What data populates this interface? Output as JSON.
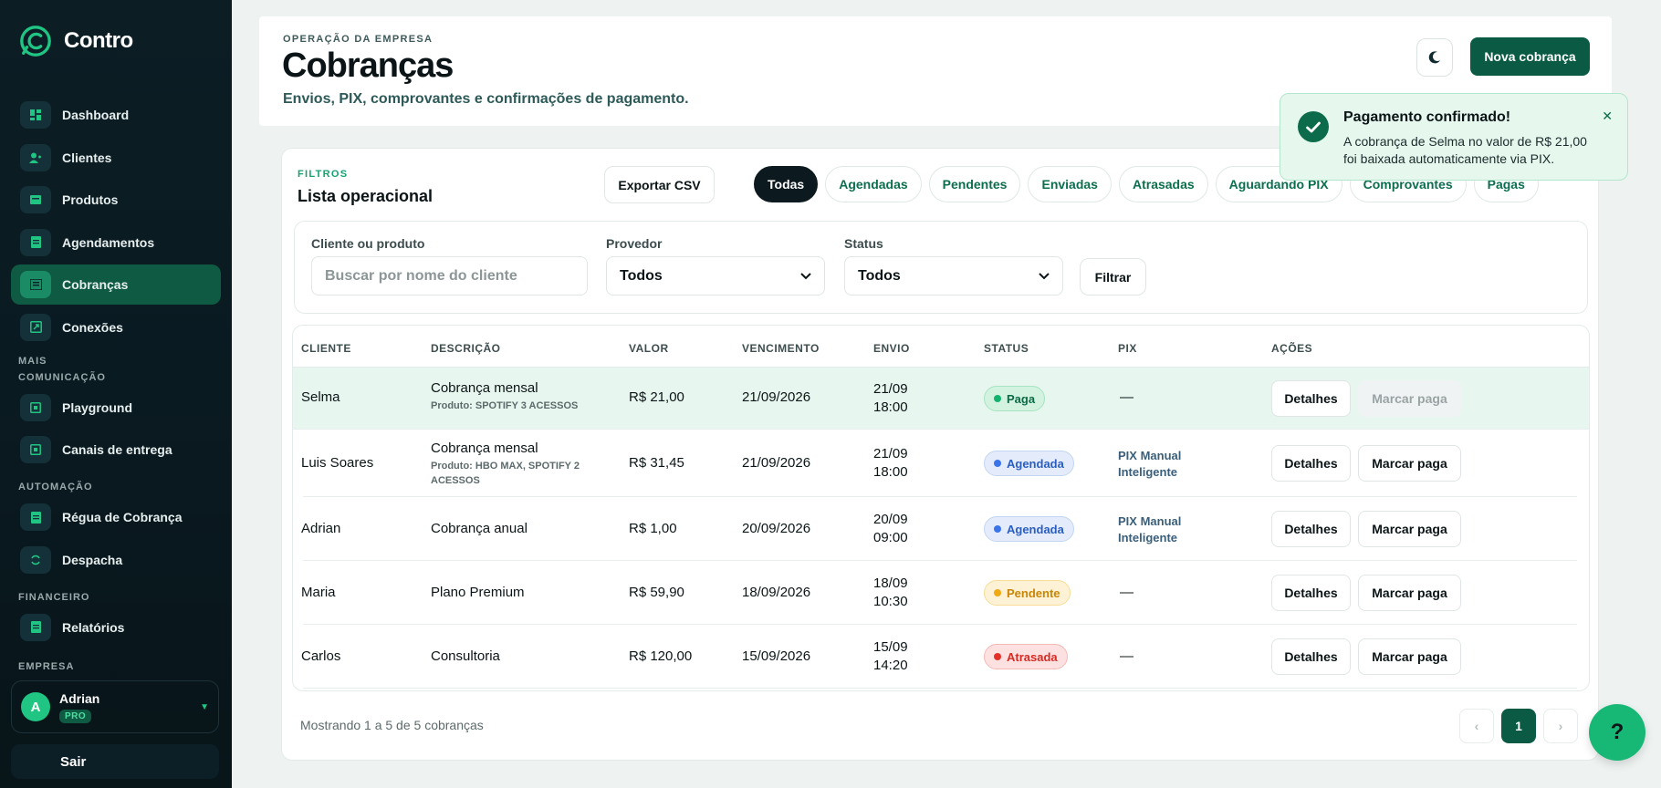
{
  "app": {
    "name": "Contro"
  },
  "sidebar": {
    "items": [
      {
        "label": "Dashboard",
        "icon": "dashboard-icon"
      },
      {
        "label": "Clientes",
        "icon": "users-icon"
      },
      {
        "label": "Produtos",
        "icon": "box-icon"
      },
      {
        "label": "Agendamentos",
        "icon": "calendar-icon"
      },
      {
        "label": "Cobranças",
        "icon": "receipt-icon",
        "active": true
      },
      {
        "label": "Conexões",
        "icon": "link-icon"
      }
    ],
    "sections": [
      {
        "title": "MAIS COMUNICAÇÃO",
        "items": [
          {
            "label": "Playground"
          },
          {
            "label": "Canais de entrega"
          }
        ]
      },
      {
        "title": "AUTOMAÇÃO",
        "items": [
          {
            "label": "Régua de Cobrança"
          },
          {
            "label": "Despacha"
          }
        ]
      },
      {
        "title": "FINANCEIRO",
        "items": [
          {
            "label": "Relatórios"
          }
        ]
      },
      {
        "title": "EMPRESA"
      }
    ],
    "user": {
      "initial": "A",
      "name": "Adrian",
      "plan": "PRO"
    },
    "logout_label": "Sair"
  },
  "header": {
    "eyebrow": "OPERAÇÃO DA EMPRESA",
    "title": "Cobranças",
    "subtitle": "Envios, PIX, comprovantes e confirmações de pagamento.",
    "new_button": "Nova cobrança"
  },
  "filters": {
    "eyebrow": "FILTROS",
    "title": "Lista operacional",
    "export_label": "Exportar CSV",
    "chips": [
      "Todas",
      "Agendadas",
      "Pendentes",
      "Enviadas",
      "Atrasadas",
      "Aguardando PIX",
      "Comprovantes",
      "Pagas"
    ],
    "active_chip": "Todas",
    "client_label": "Cliente ou produto",
    "client_placeholder": "Buscar por nome do cliente",
    "provider_label": "Provedor",
    "provider_value": "Todos",
    "status_label": "Status",
    "status_value": "Todos",
    "filter_button": "Filtrar"
  },
  "table": {
    "columns": [
      "CLIENTE",
      "DESCRIÇÃO",
      "VALOR",
      "VENCIMENTO",
      "ENVIO",
      "STATUS",
      "PIX",
      "AÇÕES"
    ],
    "rows": [
      {
        "client": "Selma",
        "desc": "Cobrança mensal",
        "desc_sub": "Produto: SPOTIFY 3 ACESSOS",
        "value": "R$ 21,00",
        "due": "21/09/2026",
        "send_date": "21/09",
        "send_time": "18:00",
        "status": "Paga",
        "status_kind": "paga",
        "pix_line1": "—",
        "pix_line2": "",
        "details": "Detalhes",
        "mark": "Marcar paga",
        "mark_disabled": true
      },
      {
        "client": "Luis Soares",
        "desc": "Cobrança mensal",
        "desc_sub": "Produto: HBO MAX, SPOTIFY 2 ACESSOS",
        "value": "R$ 31,45",
        "due": "21/09/2026",
        "send_date": "21/09",
        "send_time": "18:00",
        "status": "Agendada",
        "status_kind": "agendada",
        "pix_line1": "PIX Manual",
        "pix_line2": "Inteligente",
        "details": "Detalhes",
        "mark": "Marcar paga"
      },
      {
        "client": "Adrian",
        "desc": "Cobrança anual",
        "desc_sub": "",
        "value": "R$ 1,00",
        "due": "20/09/2026",
        "send_date": "20/09",
        "send_time": "09:00",
        "status": "Agendada",
        "status_kind": "agendada",
        "pix_line1": "PIX Manual",
        "pix_line2": "Inteligente",
        "details": "Detalhes",
        "mark": "Marcar paga"
      },
      {
        "client": "Maria",
        "desc": "Plano Premium",
        "desc_sub": "",
        "value": "R$ 59,90",
        "due": "18/09/2026",
        "send_date": "18/09",
        "send_time": "10:30",
        "status": "Pendente",
        "status_kind": "pendente",
        "pix_line1": "—",
        "pix_line2": "",
        "details": "Detalhes",
        "mark": "Marcar paga"
      },
      {
        "client": "Carlos",
        "desc": "Consultoria",
        "desc_sub": "",
        "value": "R$ 120,00",
        "due": "15/09/2026",
        "send_date": "15/09",
        "send_time": "14:20",
        "status": "Atrasada",
        "status_kind": "atrasada",
        "pix_line1": "—",
        "pix_line2": "",
        "details": "Detalhes",
        "mark": "Marcar paga"
      }
    ],
    "footer": "Mostrando 1 a 5 de 5 cobranças",
    "page": "1",
    "prev": "‹",
    "next": "›"
  },
  "toast": {
    "title": "Pagamento confirmado!",
    "message": "A cobrança de Selma no valor de R$ 21,00 foi baixada automaticamente via PIX.",
    "close": "✕"
  },
  "help": {
    "label": "?"
  },
  "colors": {
    "brand": "#0b5b44",
    "accent": "#20c483",
    "sidebar_bg": "#0a1a21"
  }
}
